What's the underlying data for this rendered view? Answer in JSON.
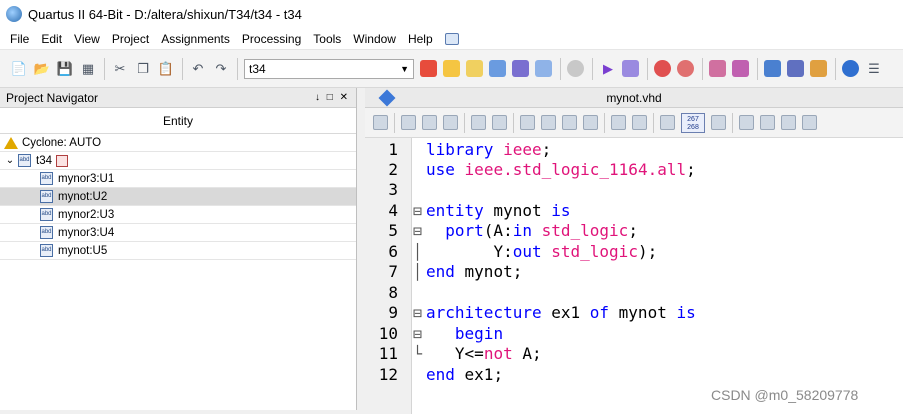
{
  "window": {
    "title": "Quartus II 64-Bit - D:/altera/shixun/T34/t34 - t34"
  },
  "menu": [
    "File",
    "Edit",
    "View",
    "Project",
    "Assignments",
    "Processing",
    "Tools",
    "Window",
    "Help"
  ],
  "toolbar": {
    "project_select_value": "t34"
  },
  "navigator": {
    "title": "Project Navigator",
    "controls": "↓ □ ✕",
    "column_header": "Entity",
    "device": "Cyclone: AUTO",
    "top_entity": "t34",
    "children": [
      "mynor3:U1",
      "mynot:U2",
      "mynor2:U3",
      "mynor3:U4",
      "mynot:U5"
    ],
    "selected_index": 1
  },
  "editor": {
    "filename": "mynot.vhd",
    "toolbar_number_badge": "267\n268",
    "line_numbers": [
      "1",
      "2",
      "3",
      "4",
      "5",
      "6",
      "7",
      "8",
      "9",
      "10",
      "11",
      "12"
    ]
  },
  "code": {
    "l1_kw": "library",
    "l1_ty": "ieee",
    "l1_end": ";",
    "l2_kw": "use",
    "l2_ty": "ieee.std_logic_1164.all",
    "l2_end": ";",
    "l4_kw1": "entity",
    "l4_id": " mynot ",
    "l4_kw2": "is",
    "l5_kw": "port",
    "l5_a": "(A:",
    "l5_in": "in",
    "l5_ty": "std_logic",
    "l5_end": ";",
    "l6_a": "Y:",
    "l6_out": "out",
    "l6_ty": "std_logic",
    "l6_end": ");",
    "l7_kw": "end",
    "l7_id": " mynot;",
    "l9_kw1": "architecture",
    "l9_id1": " ex1 ",
    "l9_kw2": "of",
    "l9_id2": " mynot ",
    "l9_kw3": "is",
    "l10_kw": "begin",
    "l11_a": "Y<=",
    "l11_not": "not",
    "l11_b": " A;",
    "l12_kw": "end",
    "l12_id": " ex1;"
  },
  "watermark": "CSDN @m0_58209778"
}
